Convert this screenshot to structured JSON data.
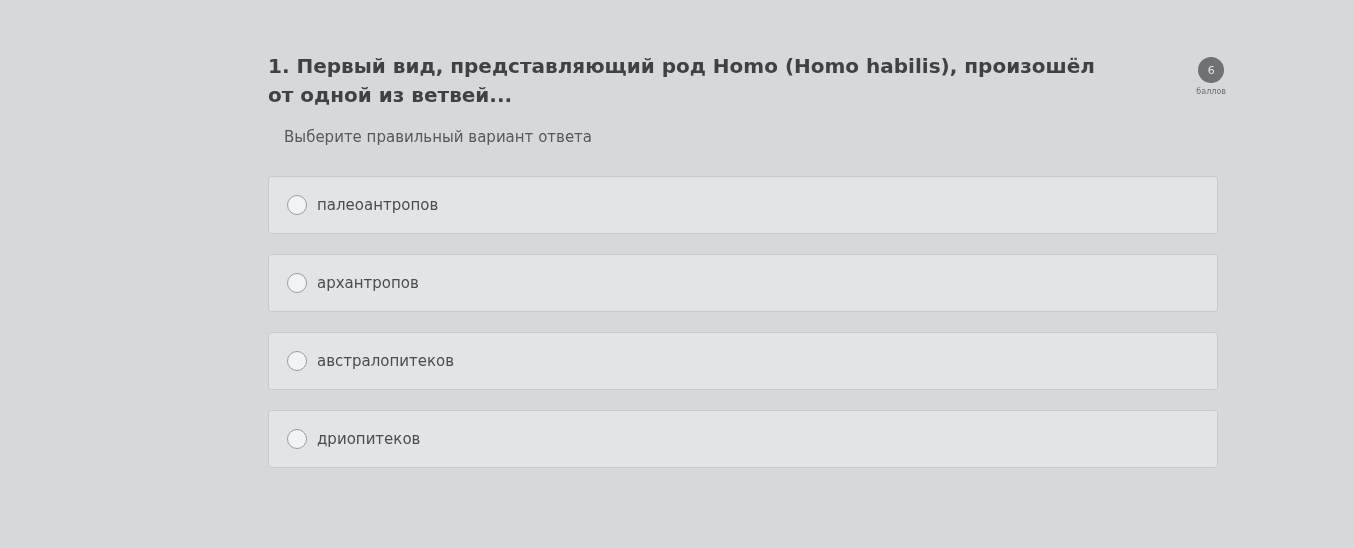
{
  "question": {
    "title": "1. Первый вид, представляющий род Homo (Homo habilis), произошёл от одной из ветвей...",
    "points": "6",
    "points_label": "баллов",
    "instruction": "Выберите правильный вариант ответа"
  },
  "options": [
    {
      "label": "палеоантропов",
      "selected": false
    },
    {
      "label": "архантропов",
      "selected": false
    },
    {
      "label": "австралопитеков",
      "selected": false
    },
    {
      "label": "дриопитеков",
      "selected": false
    }
  ]
}
